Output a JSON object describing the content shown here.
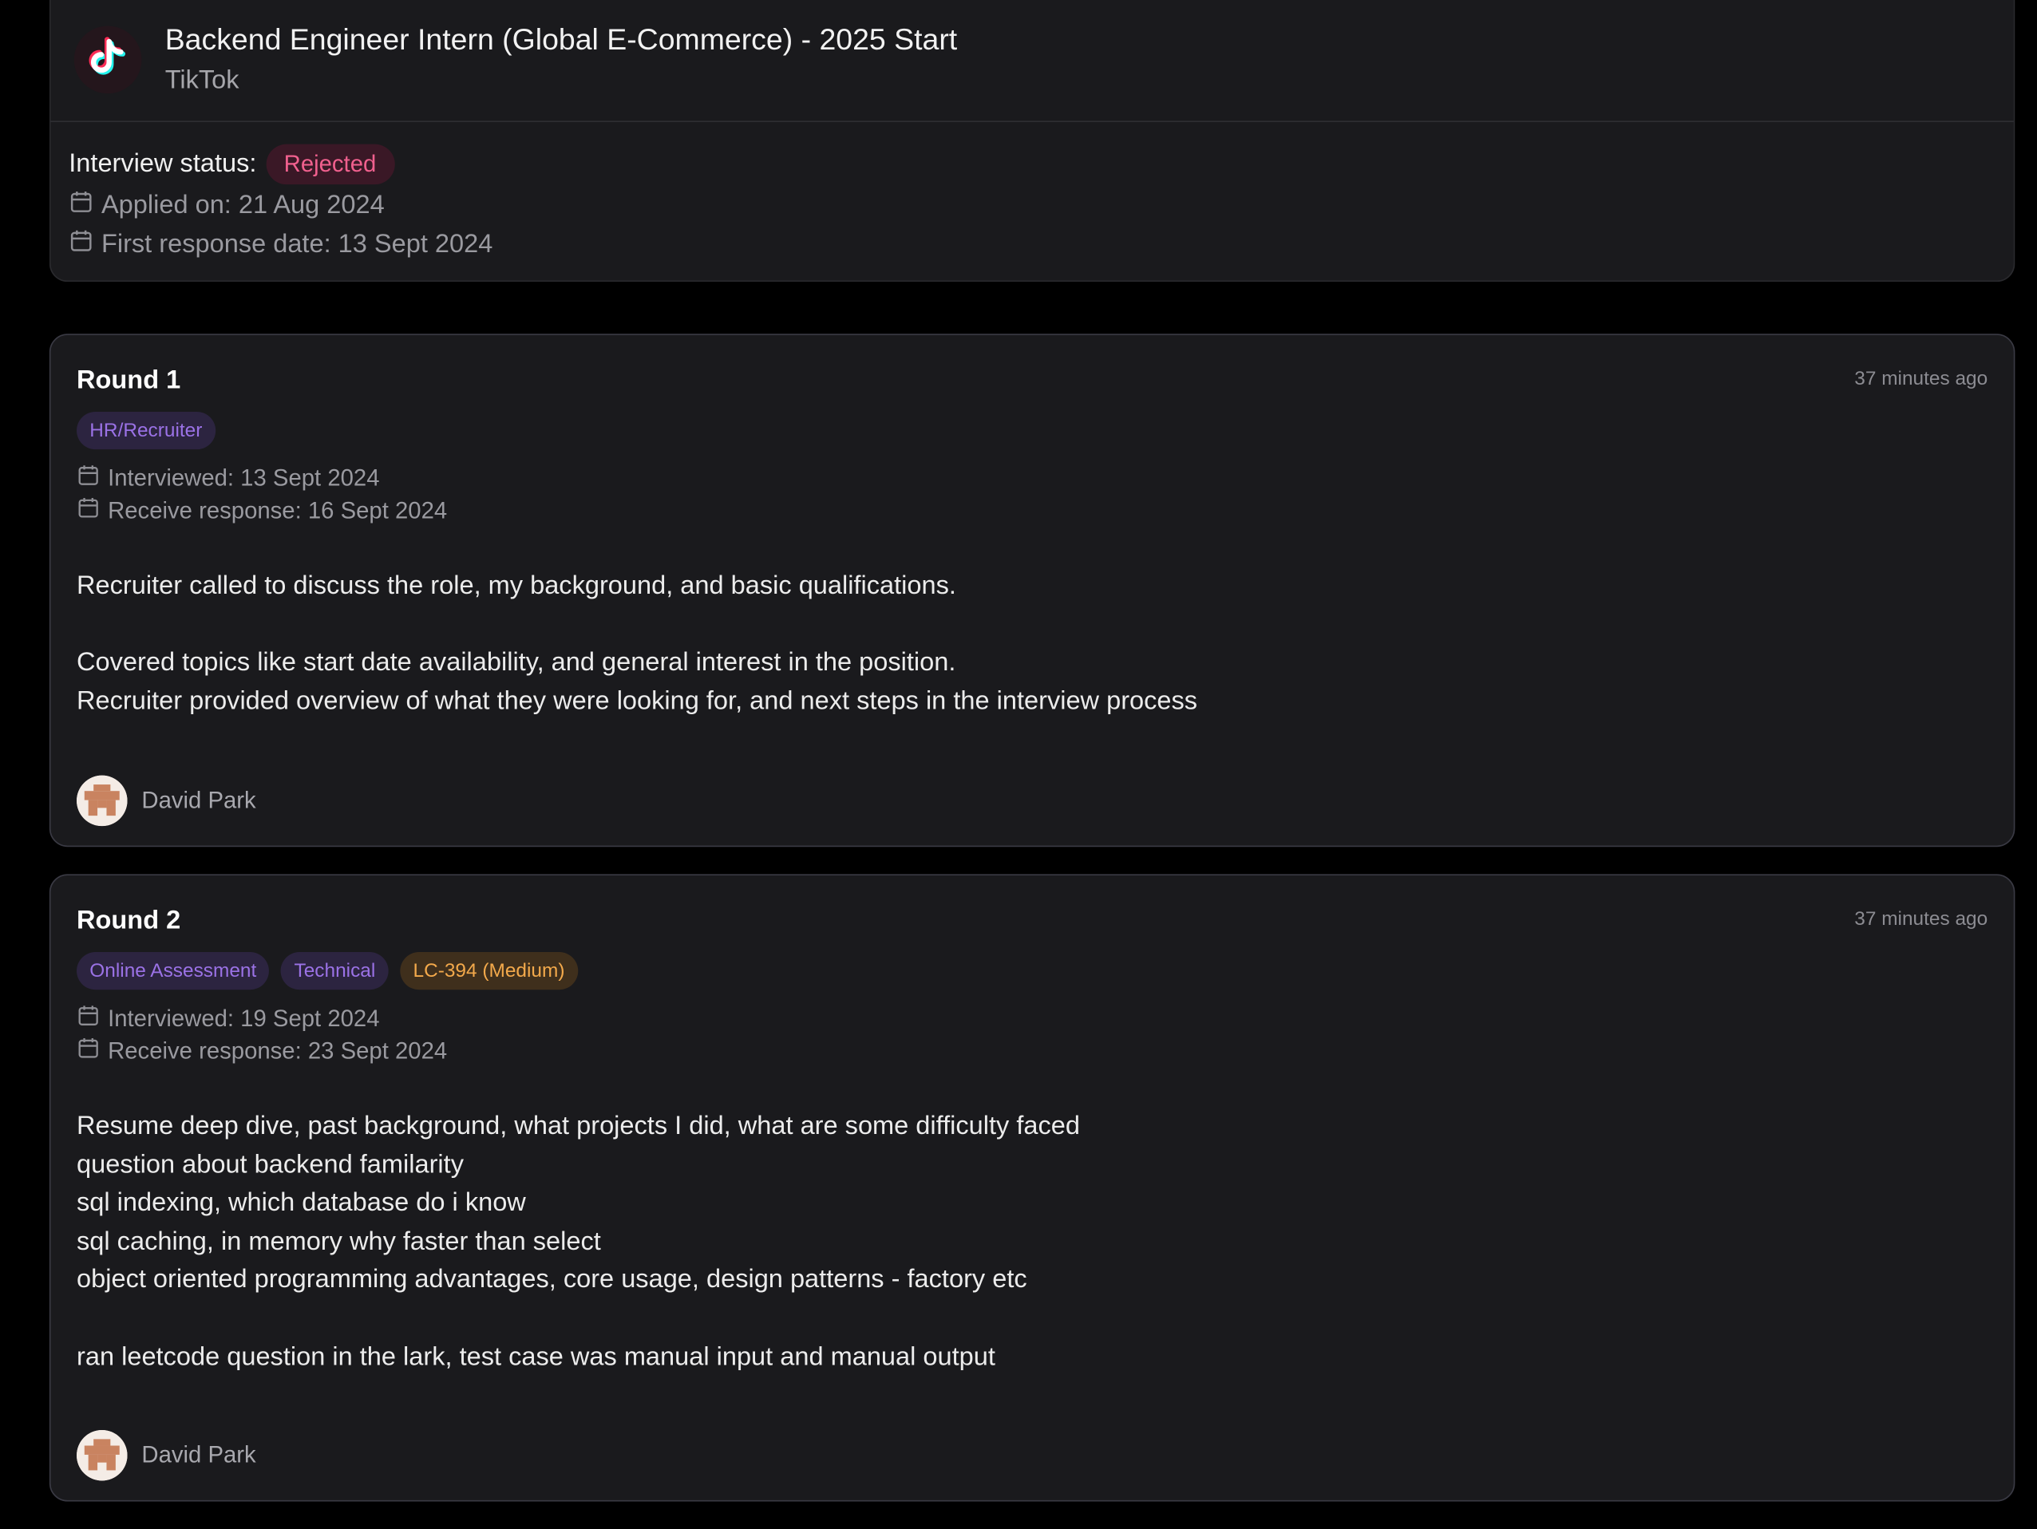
{
  "header": {
    "job_title": "Backend Engineer Intern (Global E-Commerce) - 2025 Start",
    "company": "TikTok",
    "status_label": "Interview status:",
    "status_value": "Rejected",
    "applied_on": "Applied on: 21 Aug 2024",
    "first_response": "First response date: 13 Sept 2024"
  },
  "rounds": [
    {
      "title": "Round 1",
      "time_ago": "37 minutes ago",
      "tags": [
        "HR/Recruiter"
      ],
      "interviewed": "Interviewed: 13 Sept 2024",
      "response": "Receive response: 16 Sept 2024",
      "notes": [
        "Recruiter called to discuss the role, my background, and basic qualifications.",
        "",
        "Covered topics like start date availability, and general interest in the position.",
        "Recruiter provided overview of what they were looking for, and next steps in the interview process"
      ],
      "author": "David Park"
    },
    {
      "title": "Round 2",
      "time_ago": "37 minutes ago",
      "tags": [
        "Online Assessment",
        "Technical",
        "LC-394 (Medium)"
      ],
      "interviewed": "Interviewed: 19 Sept 2024",
      "response": "Receive response: 23 Sept 2024",
      "notes": [
        "Resume deep dive, past background, what projects I did, what are some difficulty faced",
        "question about backend familarity",
        "sql indexing, which database do i know",
        "sql caching, in memory why faster than select",
        "object oriented programming advantages, core usage, design patterns - factory etc",
        "",
        "ran leetcode question in the lark, test case was manual input and manual output"
      ],
      "author": "David Park"
    }
  ],
  "colors": {
    "background": "#000000",
    "card": "#1a1a1d",
    "rejected": "#f0608e",
    "tag_purple": "#9b72e6",
    "tag_orange": "#f3a94b"
  },
  "icons": {
    "company_logo": "tiktok-logo-icon",
    "date": "calendar-icon",
    "avatar": "pixel-avatar-icon"
  }
}
